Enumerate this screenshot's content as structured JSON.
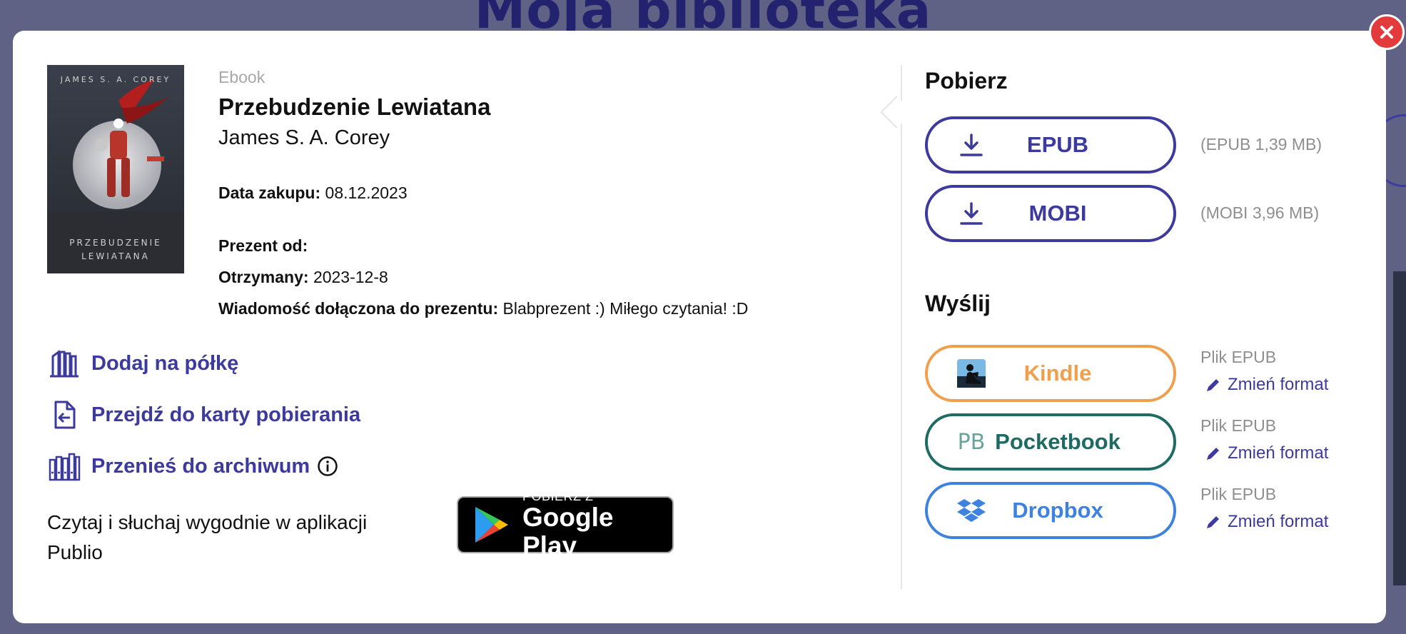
{
  "background": {
    "title": "Moja biblioteka"
  },
  "book": {
    "cover_author": "JAMES S. A. COREY",
    "cover_title_line1": "PRZEBUDZENIE",
    "cover_title_line2": "LEWIATANA",
    "type": "Ebook",
    "title": "Przebudzenie Lewiatana",
    "author": "James S. A. Corey"
  },
  "details": {
    "purchase_label": "Data zakupu:",
    "purchase_date": "08.12.2023",
    "gift_from_label": "Prezent od:",
    "received_label": "Otrzymany:",
    "received_date": "2023-12-8",
    "message_label": "Wiadomość dołączona do prezentu:",
    "message": "Blabprezent :) Miłego czytania! :D"
  },
  "actions": [
    {
      "label": "Dodaj na półkę",
      "icon": "shelf-icon"
    },
    {
      "label": "Przejdź do karty pobierania",
      "icon": "download-card-icon"
    },
    {
      "label": "Przenieś do archiwum",
      "icon": "archive-icon"
    }
  ],
  "promo": {
    "text": "Czytaj i słuchaj wygodnie w aplikacji Publio",
    "badge_small": "POBIERZ Z",
    "badge_big": "Google Play"
  },
  "download": {
    "title": "Pobierz",
    "items": [
      {
        "label": "EPUB",
        "size": "(EPUB 1,39 MB)"
      },
      {
        "label": "MOBI",
        "size": "(MOBI 3,96 MB)"
      }
    ]
  },
  "send": {
    "title": "Wyślij",
    "items": [
      {
        "label": "Kindle",
        "file": "Plik EPUB",
        "change": "Zmień format"
      },
      {
        "label": "Pocketbook",
        "icon_text": "PB",
        "file": "Plik EPUB",
        "change": "Zmień format"
      },
      {
        "label": "Dropbox",
        "file": "Plik EPUB",
        "change": "Zmień format"
      }
    ]
  },
  "colors": {
    "accent": "#3d3a9e",
    "kindle": "#f0a04c",
    "pocketbook": "#1e6b63",
    "dropbox": "#3d82de",
    "close": "#e33b3b"
  }
}
